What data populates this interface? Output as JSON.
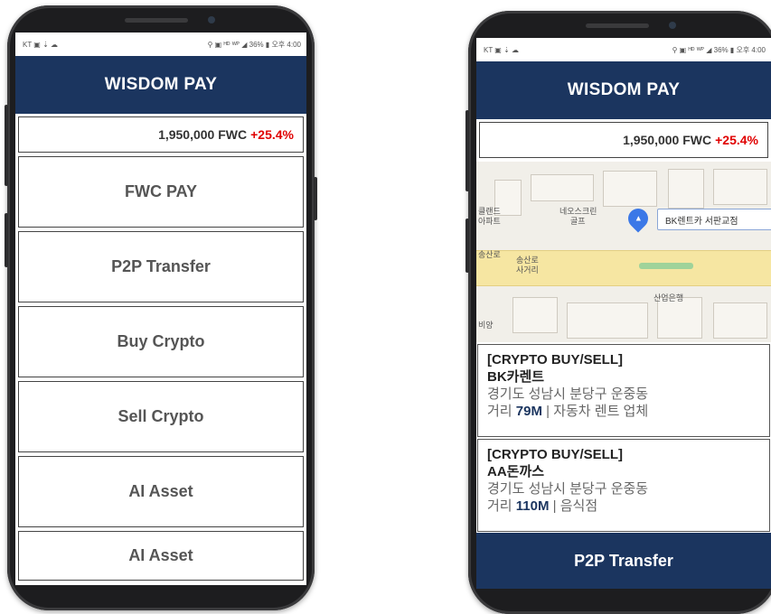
{
  "left_phone": {
    "status": {
      "left": "KT ▣ ⇣ ☁",
      "right": "⚲ ▣ ᴴᴰ ᵂᴾ ◢ 36% ▮ 오후 4:00"
    },
    "app_title": "WISDOM PAY",
    "balance": {
      "amount": "1,950,000 FWC",
      "change": "+25.4%"
    },
    "menu": [
      {
        "label": "FWC PAY"
      },
      {
        "label": "P2P Transfer"
      },
      {
        "label": "Buy Crypto"
      },
      {
        "label": "Sell Crypto"
      },
      {
        "label": "AI Asset"
      },
      {
        "label": "AI Asset"
      }
    ]
  },
  "right_phone": {
    "status": {
      "left": "KT ▣ ⇣ ☁",
      "right": "⚲ ▣ ᴴᴰ ᵂᴾ ◢ 36% ▮ 오후 4:00"
    },
    "app_title": "WISDOM PAY",
    "balance": {
      "amount": "1,950,000 FWC",
      "change": "+25.4%"
    },
    "map": {
      "labels": {
        "l1": "클랜드",
        "l2": "아파트",
        "l3": "네오스크린",
        "l4": "골프",
        "l5": "송산로",
        "l6": "송산로",
        "l7": "사거리",
        "l8": "산업은행",
        "l9": "비양"
      },
      "callout": "BK렌트카 서판교점"
    },
    "listings": [
      {
        "tag": "[CRYPTO  BUY/SELL]",
        "name": "BK카렌트",
        "address": "경기도 성남시 분당구 운중동",
        "dist_prefix": "거리 ",
        "distance": "79M",
        "category": " | 자동차 렌트 업체"
      },
      {
        "tag": "[CRYPTO  BUY/SELL]",
        "name": "AA돈까스",
        "address": "경기도 성남시 분당구 운중동",
        "dist_prefix": "거리 ",
        "distance": "110M",
        "category": " | 음식점"
      }
    ],
    "bottom_button": "P2P Transfer"
  },
  "colors": {
    "brand_navy": "#1b355f",
    "change_red": "#e00000"
  }
}
